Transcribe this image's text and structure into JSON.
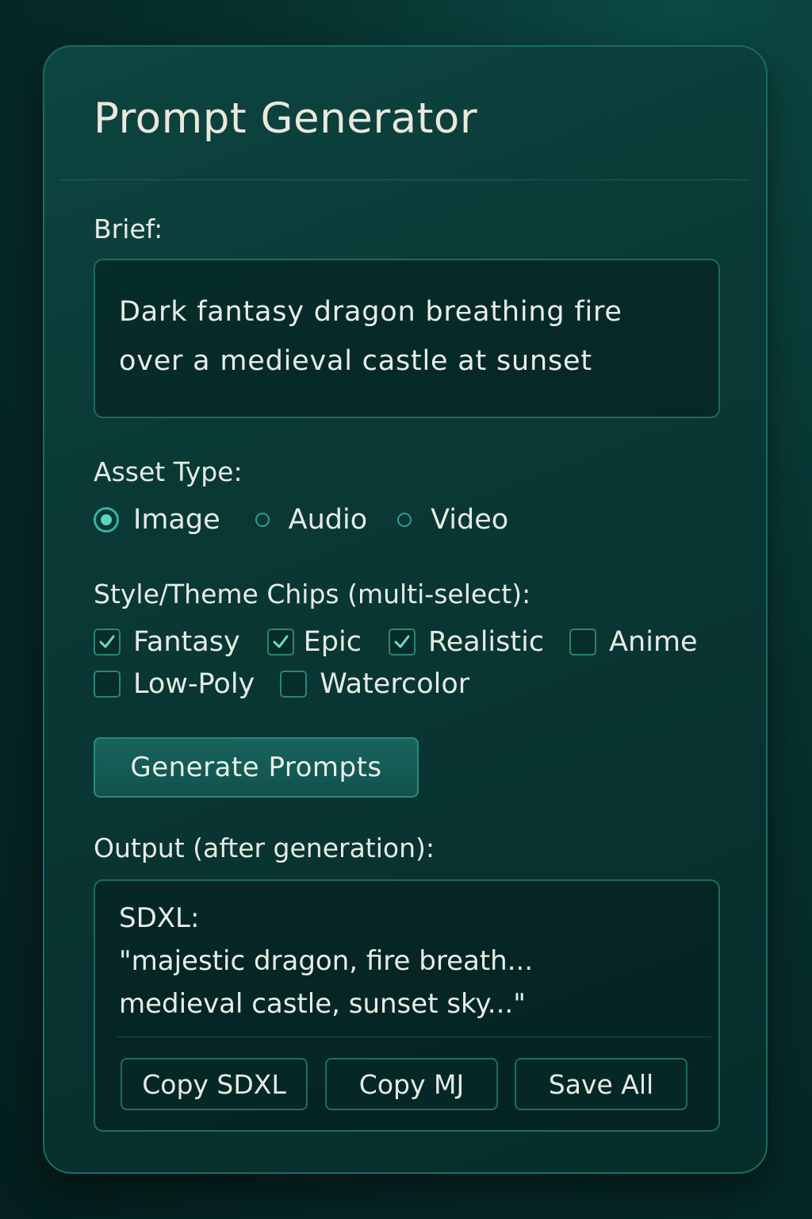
{
  "title": "Prompt Generator",
  "brief": {
    "label": "Brief:",
    "line1": "Dark fantasy dragon breathing fire",
    "line2": "over a medieval castle at sunset"
  },
  "asset_type": {
    "label": "Asset Type:",
    "options": [
      {
        "label": "Image",
        "selected": true
      },
      {
        "label": "Audio",
        "selected": false
      },
      {
        "label": "Video",
        "selected": false
      }
    ]
  },
  "style": {
    "label": "Style/Theme Chips (multi-select):",
    "chips": [
      {
        "label": "Fantasy",
        "checked": true
      },
      {
        "label": "Epic",
        "checked": true
      },
      {
        "label": "Realistic",
        "checked": true
      },
      {
        "label": "Anime",
        "checked": false
      },
      {
        "label": "Low-Poly",
        "checked": false
      },
      {
        "label": "Watercolor",
        "checked": false
      }
    ]
  },
  "generate_label": "Generate Prompts",
  "output": {
    "label": "Output (after generation):",
    "heading": "SDXL:",
    "line1": "\"majestic dragon, fire breath...",
    "line2": "medieval castle, sunset sky...\"",
    "buttons": {
      "copy_sdxl": "Copy SDXL",
      "copy_mj": "Copy MJ",
      "save_all": "Save All"
    }
  },
  "colors": {
    "accent": "#35b3a1",
    "panel_border": "#1b6a63",
    "text": "#e6ebe4"
  },
  "icons": {
    "checkmark": "check-icon",
    "radio": "radio-icon"
  }
}
